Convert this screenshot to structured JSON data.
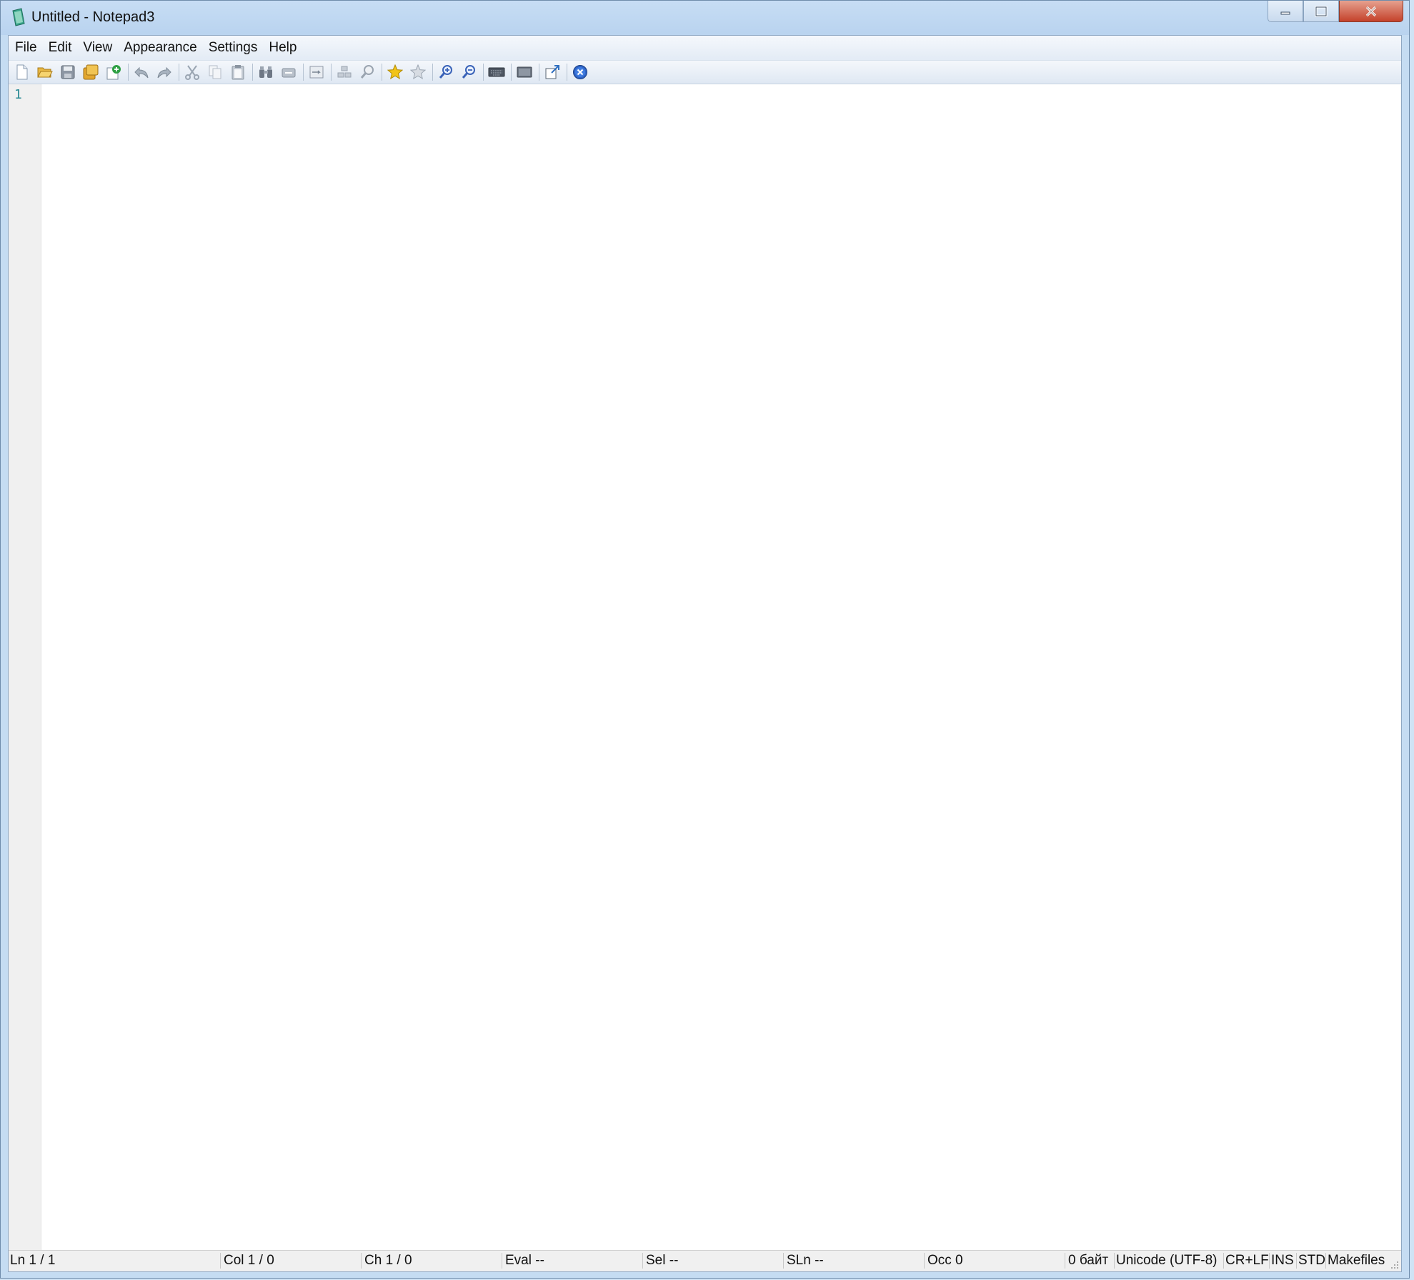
{
  "window": {
    "title": "Untitled - Notepad3",
    "controls": {
      "minimize": "minimize-icon",
      "maximize": "maximize-icon",
      "close": "close-icon"
    }
  },
  "menu": {
    "items": [
      {
        "label": "File"
      },
      {
        "label": "Edit"
      },
      {
        "label": "View"
      },
      {
        "label": "Appearance"
      },
      {
        "label": "Settings"
      },
      {
        "label": "Help"
      }
    ]
  },
  "toolbar": {
    "buttons": [
      "new-file-icon",
      "open-file-icon",
      "save-icon",
      "save-as-icon",
      "save-copy-icon",
      "undo-icon",
      "redo-icon",
      "cut-icon",
      "copy-icon",
      "paste-icon",
      "find-icon",
      "replace-icon",
      "word-wrap-icon",
      "zoom-find-icon",
      "zoom-hint-icon",
      "favorites-icon",
      "add-favorite-icon",
      "zoom-in-icon",
      "zoom-out-icon",
      "keyboard-icon",
      "schemes-icon",
      "launch-icon",
      "exit-icon"
    ]
  },
  "editor": {
    "line_numbers": [
      "1"
    ],
    "content": ""
  },
  "status": {
    "ln": "Ln  1 / 1",
    "col": "Col  1 / 0",
    "ch": "Ch  1 / 0",
    "eval": "Eval  --",
    "sel": "Sel  --",
    "sln": "SLn  --",
    "occ": "Occ  0",
    "size": "0 байт",
    "encoding": "Unicode (UTF-8)",
    "eol": "CR+LF",
    "ins": "INS",
    "std": "STD",
    "lexer": "Makefiles"
  },
  "colors": {
    "line_number": "#2a8a94",
    "title_bar": "#c5dcf2",
    "close_button": "#c4412a"
  }
}
